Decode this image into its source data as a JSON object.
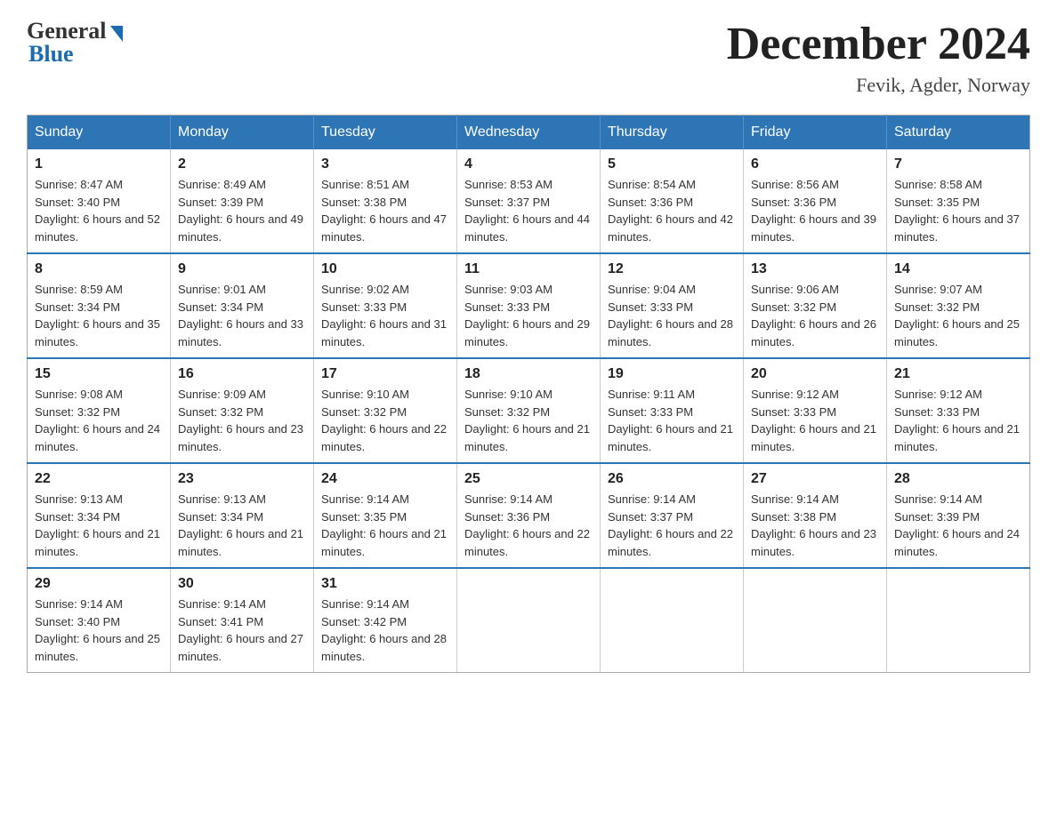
{
  "header": {
    "logo_general": "General",
    "logo_blue": "Blue",
    "month_title": "December 2024",
    "location": "Fevik, Agder, Norway"
  },
  "calendar": {
    "days_of_week": [
      "Sunday",
      "Monday",
      "Tuesday",
      "Wednesday",
      "Thursday",
      "Friday",
      "Saturday"
    ],
    "weeks": [
      [
        {
          "day": "1",
          "sunrise": "8:47 AM",
          "sunset": "3:40 PM",
          "daylight": "6 hours and 52 minutes."
        },
        {
          "day": "2",
          "sunrise": "8:49 AM",
          "sunset": "3:39 PM",
          "daylight": "6 hours and 49 minutes."
        },
        {
          "day": "3",
          "sunrise": "8:51 AM",
          "sunset": "3:38 PM",
          "daylight": "6 hours and 47 minutes."
        },
        {
          "day": "4",
          "sunrise": "8:53 AM",
          "sunset": "3:37 PM",
          "daylight": "6 hours and 44 minutes."
        },
        {
          "day": "5",
          "sunrise": "8:54 AM",
          "sunset": "3:36 PM",
          "daylight": "6 hours and 42 minutes."
        },
        {
          "day": "6",
          "sunrise": "8:56 AM",
          "sunset": "3:36 PM",
          "daylight": "6 hours and 39 minutes."
        },
        {
          "day": "7",
          "sunrise": "8:58 AM",
          "sunset": "3:35 PM",
          "daylight": "6 hours and 37 minutes."
        }
      ],
      [
        {
          "day": "8",
          "sunrise": "8:59 AM",
          "sunset": "3:34 PM",
          "daylight": "6 hours and 35 minutes."
        },
        {
          "day": "9",
          "sunrise": "9:01 AM",
          "sunset": "3:34 PM",
          "daylight": "6 hours and 33 minutes."
        },
        {
          "day": "10",
          "sunrise": "9:02 AM",
          "sunset": "3:33 PM",
          "daylight": "6 hours and 31 minutes."
        },
        {
          "day": "11",
          "sunrise": "9:03 AM",
          "sunset": "3:33 PM",
          "daylight": "6 hours and 29 minutes."
        },
        {
          "day": "12",
          "sunrise": "9:04 AM",
          "sunset": "3:33 PM",
          "daylight": "6 hours and 28 minutes."
        },
        {
          "day": "13",
          "sunrise": "9:06 AM",
          "sunset": "3:32 PM",
          "daylight": "6 hours and 26 minutes."
        },
        {
          "day": "14",
          "sunrise": "9:07 AM",
          "sunset": "3:32 PM",
          "daylight": "6 hours and 25 minutes."
        }
      ],
      [
        {
          "day": "15",
          "sunrise": "9:08 AM",
          "sunset": "3:32 PM",
          "daylight": "6 hours and 24 minutes."
        },
        {
          "day": "16",
          "sunrise": "9:09 AM",
          "sunset": "3:32 PM",
          "daylight": "6 hours and 23 minutes."
        },
        {
          "day": "17",
          "sunrise": "9:10 AM",
          "sunset": "3:32 PM",
          "daylight": "6 hours and 22 minutes."
        },
        {
          "day": "18",
          "sunrise": "9:10 AM",
          "sunset": "3:32 PM",
          "daylight": "6 hours and 21 minutes."
        },
        {
          "day": "19",
          "sunrise": "9:11 AM",
          "sunset": "3:33 PM",
          "daylight": "6 hours and 21 minutes."
        },
        {
          "day": "20",
          "sunrise": "9:12 AM",
          "sunset": "3:33 PM",
          "daylight": "6 hours and 21 minutes."
        },
        {
          "day": "21",
          "sunrise": "9:12 AM",
          "sunset": "3:33 PM",
          "daylight": "6 hours and 21 minutes."
        }
      ],
      [
        {
          "day": "22",
          "sunrise": "9:13 AM",
          "sunset": "3:34 PM",
          "daylight": "6 hours and 21 minutes."
        },
        {
          "day": "23",
          "sunrise": "9:13 AM",
          "sunset": "3:34 PM",
          "daylight": "6 hours and 21 minutes."
        },
        {
          "day": "24",
          "sunrise": "9:14 AM",
          "sunset": "3:35 PM",
          "daylight": "6 hours and 21 minutes."
        },
        {
          "day": "25",
          "sunrise": "9:14 AM",
          "sunset": "3:36 PM",
          "daylight": "6 hours and 22 minutes."
        },
        {
          "day": "26",
          "sunrise": "9:14 AM",
          "sunset": "3:37 PM",
          "daylight": "6 hours and 22 minutes."
        },
        {
          "day": "27",
          "sunrise": "9:14 AM",
          "sunset": "3:38 PM",
          "daylight": "6 hours and 23 minutes."
        },
        {
          "day": "28",
          "sunrise": "9:14 AM",
          "sunset": "3:39 PM",
          "daylight": "6 hours and 24 minutes."
        }
      ],
      [
        {
          "day": "29",
          "sunrise": "9:14 AM",
          "sunset": "3:40 PM",
          "daylight": "6 hours and 25 minutes."
        },
        {
          "day": "30",
          "sunrise": "9:14 AM",
          "sunset": "3:41 PM",
          "daylight": "6 hours and 27 minutes."
        },
        {
          "day": "31",
          "sunrise": "9:14 AM",
          "sunset": "3:42 PM",
          "daylight": "6 hours and 28 minutes."
        },
        null,
        null,
        null,
        null
      ]
    ]
  }
}
